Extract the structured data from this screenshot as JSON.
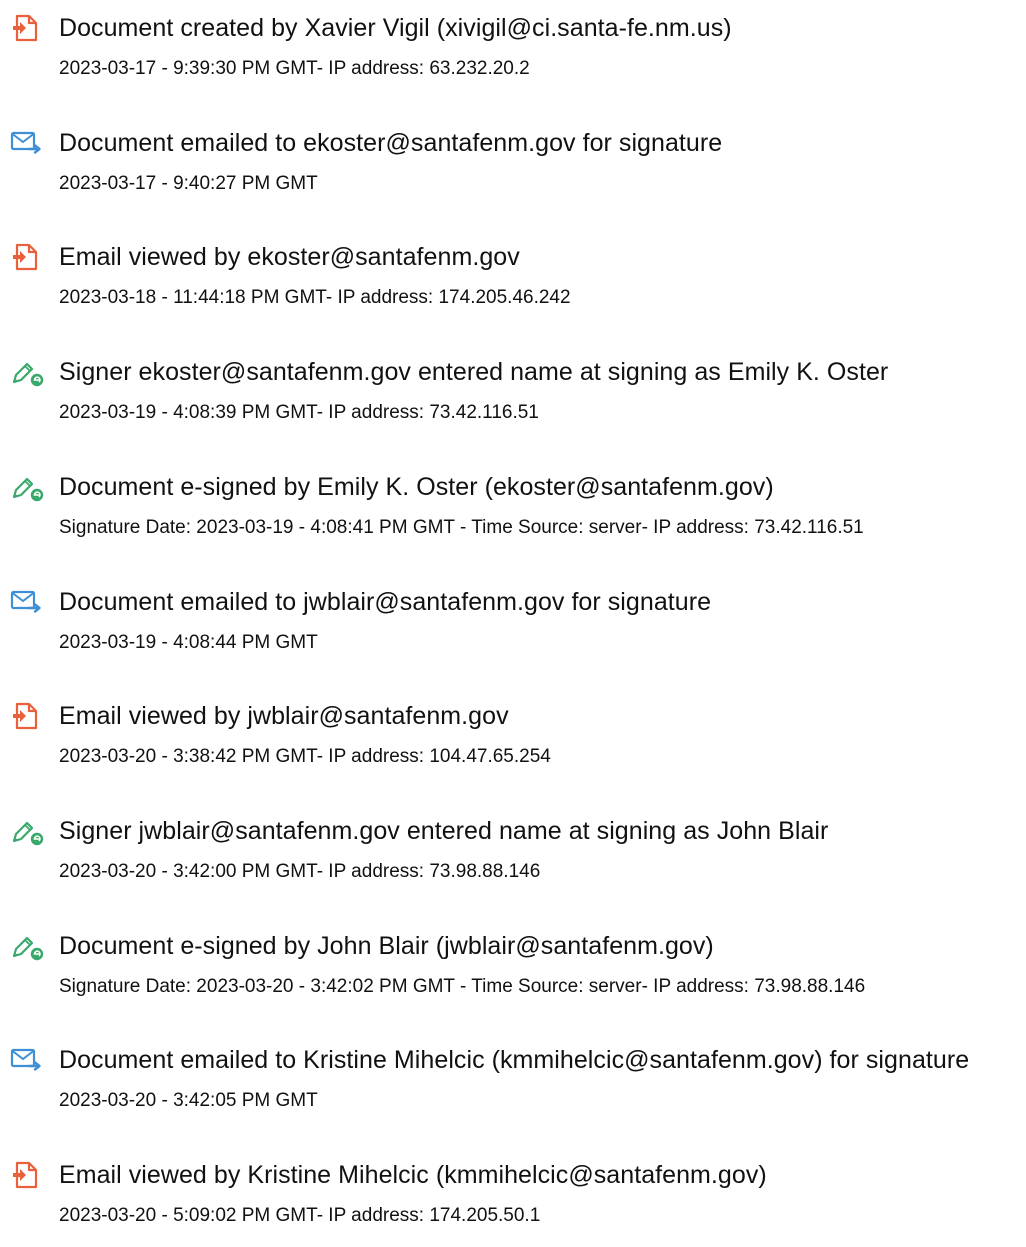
{
  "colors": {
    "doc_icon": "#e8603c",
    "email_icon": "#3f8fd6",
    "sign_icon": "#3aa86b",
    "text": "#111111"
  },
  "entries": [
    {
      "icon": "document-icon",
      "event": "Document created by Xavier Vigil (xivigil@ci.santa-fe.nm.us)",
      "detail": "2023-03-17 - 9:39:30 PM GMT- IP address: 63.232.20.2"
    },
    {
      "icon": "email-sent-icon",
      "event": "Document emailed to ekoster@santafenm.gov for signature",
      "detail": "2023-03-17 - 9:40:27 PM GMT"
    },
    {
      "icon": "document-icon",
      "event": "Email viewed by ekoster@santafenm.gov",
      "detail": "2023-03-18 - 11:44:18 PM GMT- IP address: 174.205.46.242"
    },
    {
      "icon": "signature-pen-icon",
      "event": "Signer ekoster@santafenm.gov entered name at signing as Emily K. Oster",
      "detail": "2023-03-19 - 4:08:39 PM GMT- IP address: 73.42.116.51"
    },
    {
      "icon": "signature-pen-icon",
      "event": "Document e-signed by Emily K. Oster (ekoster@santafenm.gov)",
      "detail": "Signature Date: 2023-03-19 - 4:08:41 PM GMT - Time Source: server- IP address: 73.42.116.51"
    },
    {
      "icon": "email-sent-icon",
      "event": "Document emailed to jwblair@santafenm.gov for signature",
      "detail": "2023-03-19 - 4:08:44 PM GMT"
    },
    {
      "icon": "document-icon",
      "event": "Email viewed by jwblair@santafenm.gov",
      "detail": "2023-03-20 - 3:38:42 PM GMT- IP address: 104.47.65.254"
    },
    {
      "icon": "signature-pen-icon",
      "event": "Signer jwblair@santafenm.gov entered name at signing as John Blair",
      "detail": "2023-03-20 - 3:42:00 PM GMT- IP address: 73.98.88.146"
    },
    {
      "icon": "signature-pen-icon",
      "event": "Document e-signed by John Blair (jwblair@santafenm.gov)",
      "detail": "Signature Date: 2023-03-20 - 3:42:02 PM GMT - Time Source: server- IP address: 73.98.88.146"
    },
    {
      "icon": "email-sent-icon",
      "event": "Document emailed to Kristine Mihelcic (kmmihelcic@santafenm.gov) for signature",
      "detail": "2023-03-20 - 3:42:05 PM GMT"
    },
    {
      "icon": "document-icon",
      "event": "Email viewed by Kristine Mihelcic (kmmihelcic@santafenm.gov)",
      "detail": "2023-03-20 - 5:09:02 PM GMT- IP address: 174.205.50.1"
    }
  ]
}
